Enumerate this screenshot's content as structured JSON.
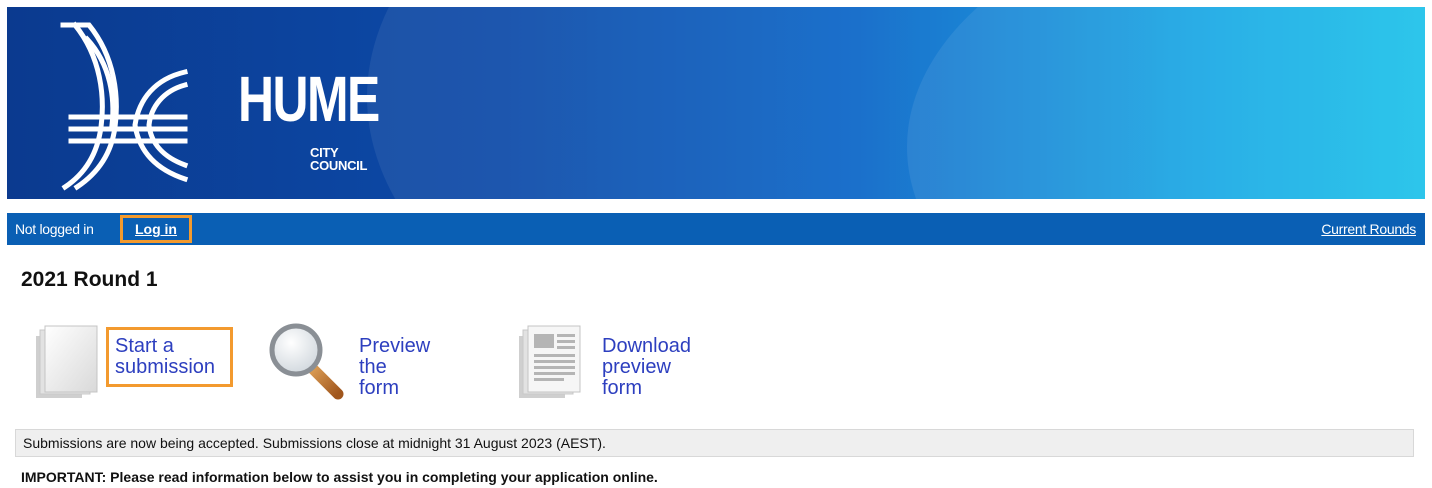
{
  "header": {
    "logo_word": "HUME",
    "logo_sub": "CITY COUNCIL"
  },
  "nav": {
    "status": "Not logged in",
    "login_label": "Log in",
    "rounds_label": "Current Rounds"
  },
  "round": {
    "title": "2021 Round 1"
  },
  "actions": {
    "start": {
      "line1": "Start a",
      "line2": "submission",
      "icon": "blank-document-icon"
    },
    "preview": {
      "line1": "Preview",
      "line2": "the form",
      "icon": "magnifier-icon"
    },
    "download": {
      "line1": "Download",
      "line2": "preview form",
      "icon": "form-document-icon"
    }
  },
  "notice": "Submissions are now being accepted. Submissions close at midnight 31 August 2023 (AEST).",
  "important": "IMPORTANT: Please read information below to assist you in completing your application online.",
  "colors": {
    "nav_bg": "#0a5fb4",
    "link": "#2d3fbf",
    "highlight": "#f39a2e"
  }
}
